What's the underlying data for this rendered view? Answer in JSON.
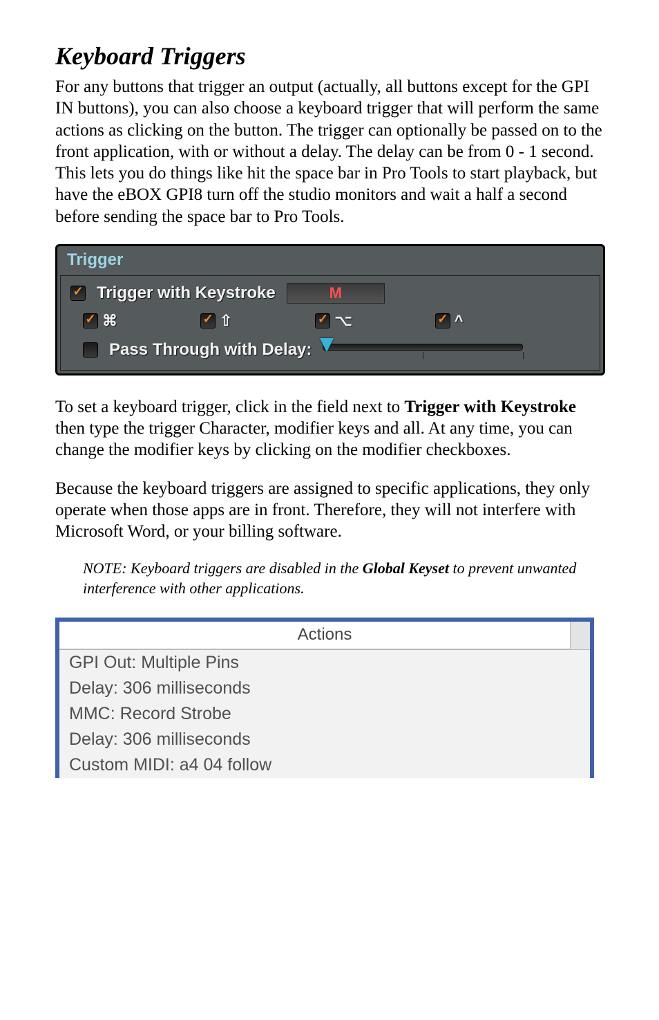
{
  "heading": "Keyboard Triggers",
  "para1": "For any buttons that trigger an output (actually, all buttons except for the GPI IN buttons), you can also choose a keyboard trigger that will perform the same actions as clicking on the button. The trigger can optionally be passed on to the front application, with or without a delay.  The delay can be from 0 - 1 second. This lets you do things like hit the space bar in Pro Tools to start playback, but have the eBOX GPI8 turn off the studio monitors and wait a half a second before sending the space bar to Pro Tools.",
  "trigger_panel": {
    "title": "Trigger",
    "with_keystroke_label": "Trigger with Keystroke",
    "keystroke_value": "M",
    "modifiers": {
      "cmd": {
        "symbol": "⌘",
        "checked": true
      },
      "shift": {
        "symbol": "⇧",
        "checked": true
      },
      "opt": {
        "symbol": "⌥",
        "checked": true
      },
      "ctrl": {
        "symbol": "^",
        "checked": true
      }
    },
    "pass_through_label": "Pass Through with Delay:",
    "pass_through_checked": false,
    "slider_value_fraction": 0.0
  },
  "para2_pre": "To set a keyboard trigger, click in the field next to ",
  "para2_bold": "Trigger with Keystroke",
  "para2_post": " then type the trigger Character, modifier keys and all. At any time, you can change the modifier keys by clicking on the modifier checkboxes.",
  "para3": "Because the keyboard triggers are assigned to specific applications, they only operate when those apps are in front.  Therefore, they will not interfere with Microsoft Word, or your billing software.",
  "note_pre": "NOTE: Keyboard triggers are disabled in the ",
  "note_bold": "Global Keyset",
  "note_post": " to prevent unwanted interference with other applications.",
  "actions": {
    "header": "Actions",
    "items": [
      "GPI Out: Multiple Pins",
      "Delay: 306 milliseconds",
      "MMC: Record Strobe",
      "Delay: 306 milliseconds",
      "Custom MIDI: a4 04 follow"
    ]
  }
}
